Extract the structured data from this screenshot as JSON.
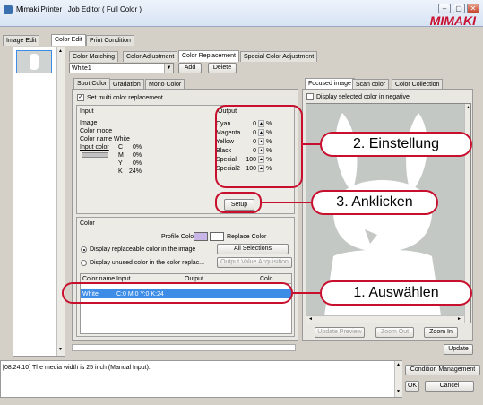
{
  "window": {
    "title": "Mimaki Printer : Job Editor ( Full Color )",
    "logo": "MIMAKI",
    "min": "–",
    "max": "▢",
    "close": "✕"
  },
  "top_tabs": [
    "Image Edit",
    "Color Edit",
    "Print Condition"
  ],
  "sub_tabs": [
    "Color Matching",
    "Color Adjustment",
    "Color Replacement",
    "Special Color Adjustment"
  ],
  "preset": {
    "value": "White1",
    "add": "Add",
    "delete": "Delete"
  },
  "inner_tabs": [
    "Spot Color",
    "Gradation",
    "Mono Color"
  ],
  "multi_replace_label": "Set multi color replacement",
  "input": {
    "heading": "Input",
    "image": "Image",
    "color_mode": "Color mode",
    "color_name_label": "Color name",
    "color_name_value": "White",
    "input_color": "Input color",
    "channels": [
      {
        "ch": "C",
        "val": "0%"
      },
      {
        "ch": "M",
        "val": "0%"
      },
      {
        "ch": "Y",
        "val": "0%"
      },
      {
        "ch": "K",
        "val": "24%"
      }
    ]
  },
  "output": {
    "heading": "Output",
    "unit": "%",
    "rows": [
      {
        "label": "Cyan",
        "value": "0"
      },
      {
        "label": "Magenta",
        "value": "0"
      },
      {
        "label": "Yellow",
        "value": "0"
      },
      {
        "label": "Black",
        "value": "0"
      },
      {
        "label": "Special",
        "value": "100"
      },
      {
        "label": "Special2",
        "value": "100"
      }
    ]
  },
  "setup_button": "Setup",
  "color_section": {
    "heading": "Color",
    "profile_color": "Profile Color",
    "replace_color": "Replace Color",
    "profile_swatch": "#c9b6e8",
    "replace_swatch": "#ffffff",
    "radio1": "Display replaceable color in the image",
    "radio2": "Display unused color in the color replac...",
    "all_selections": "All Selections",
    "output_value_acquisition": "Output Value Acquisition"
  },
  "list": {
    "headers": [
      "Color name",
      "Input",
      "Output",
      "Colo..."
    ],
    "row": {
      "name": "White",
      "input": "C:0 M:0 Y:0 K:24"
    },
    "selected_color": "#3d8de6"
  },
  "right_tabs": [
    "Focused image",
    "Scan color",
    "Color Collection"
  ],
  "negative_label": "Display selected color in negative",
  "preview": {
    "background": "#c3c8c5",
    "figure_color": "#ffffff"
  },
  "zoom": {
    "update_preview": "Update Preview",
    "zoom_out": "Zoom Out",
    "zoom_in": "Zoom In"
  },
  "update_button": "Update",
  "log": "[08:24:10] The media width is 25 inch (Manual Input).",
  "condition_management": "Condition Management",
  "ok": "OK",
  "cancel": "Cancel",
  "callouts": {
    "settings": "2. Einstellung",
    "click": "3. Anklicken",
    "select": "1. Auswählen"
  },
  "arrows": {
    "up": "▲",
    "down": "▼",
    "left": "◄",
    "right": "►",
    "dropdown": "▼",
    "check": "✓"
  }
}
